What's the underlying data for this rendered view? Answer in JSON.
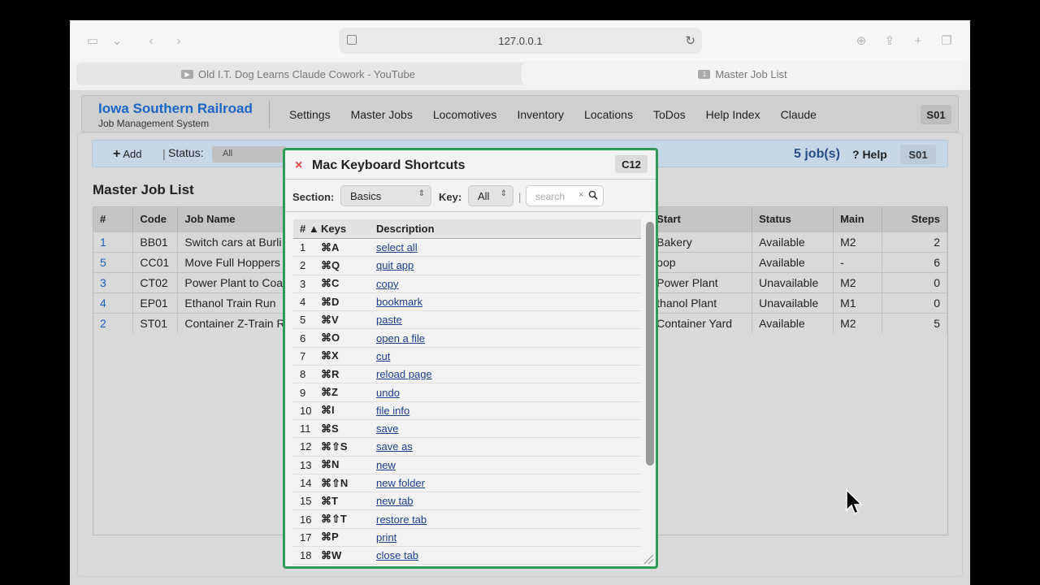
{
  "browser": {
    "url": "127.0.0.1",
    "tabs": [
      {
        "label": "Old I.T. Dog Learns Claude Cowork - YouTube",
        "active": false,
        "icon": "youtube-icon"
      },
      {
        "label": "Master Job List",
        "active": true,
        "icon": "tab-number-icon",
        "badge": "1"
      }
    ]
  },
  "header": {
    "title": "Iowa Southern Railroad",
    "subtitle": "Job Management System",
    "nav": [
      "Settings",
      "Master Jobs",
      "Locomotives",
      "Inventory",
      "Locations",
      "ToDos",
      "Help Index",
      "Claude"
    ],
    "code": "S01"
  },
  "actionbar": {
    "add_label": "Add",
    "status_label": "Status:",
    "status_value": "All",
    "job_count": "5 job(s)",
    "help_label": "? Help",
    "code": "S01"
  },
  "page_title": "Master Job List",
  "table": {
    "columns": [
      "#",
      "Code",
      "Job Name",
      "Start",
      "Status",
      "Main",
      "Steps"
    ],
    "rows": [
      {
        "id": "1",
        "code": "BB01",
        "name": "Switch cars at Burli",
        "start": "Bakery",
        "status": "Available",
        "main": "M2",
        "steps": "2"
      },
      {
        "id": "5",
        "code": "CC01",
        "name": "Move Full Hoppers",
        "start": "oop",
        "status": "Available",
        "main": "-",
        "steps": "6"
      },
      {
        "id": "3",
        "code": "CT02",
        "name": "Power Plant to Coa",
        "start": "Power Plant",
        "status": "Unavailable",
        "main": "M2",
        "steps": "0"
      },
      {
        "id": "4",
        "code": "EP01",
        "name": "Ethanol Train Run",
        "start": "thanol Plant",
        "status": "Unavailable",
        "main": "M1",
        "steps": "0"
      },
      {
        "id": "2",
        "code": "ST01",
        "name": "Container Z-Train R",
        "start": "Container Yard",
        "status": "Available",
        "main": "M2",
        "steps": "5"
      }
    ]
  },
  "modal": {
    "title": "Mac Keyboard Shortcuts",
    "code": "C12",
    "section_label": "Section:",
    "section_value": "Basics",
    "key_label": "Key:",
    "key_value": "All",
    "search_placeholder": "search",
    "columns": [
      "# ▲",
      "Keys",
      "Description"
    ],
    "rows": [
      {
        "n": "1",
        "keys": "⌘A",
        "desc": "select all"
      },
      {
        "n": "2",
        "keys": "⌘Q",
        "desc": "quit app"
      },
      {
        "n": "3",
        "keys": "⌘C",
        "desc": "copy"
      },
      {
        "n": "4",
        "keys": "⌘D",
        "desc": "bookmark"
      },
      {
        "n": "5",
        "keys": "⌘V",
        "desc": "paste"
      },
      {
        "n": "6",
        "keys": "⌘O",
        "desc": "open a file"
      },
      {
        "n": "7",
        "keys": "⌘X",
        "desc": "cut"
      },
      {
        "n": "8",
        "keys": "⌘R",
        "desc": "reload page"
      },
      {
        "n": "9",
        "keys": "⌘Z",
        "desc": "undo"
      },
      {
        "n": "10",
        "keys": "⌘I",
        "desc": "file info"
      },
      {
        "n": "11",
        "keys": "⌘S",
        "desc": "save"
      },
      {
        "n": "12",
        "keys": "⌘⇧S",
        "desc": "save as"
      },
      {
        "n": "13",
        "keys": "⌘N",
        "desc": "new"
      },
      {
        "n": "14",
        "keys": "⌘⇧N",
        "desc": "new folder"
      },
      {
        "n": "15",
        "keys": "⌘T",
        "desc": "new tab"
      },
      {
        "n": "16",
        "keys": "⌘⇧T",
        "desc": "restore tab"
      },
      {
        "n": "17",
        "keys": "⌘P",
        "desc": "print"
      },
      {
        "n": "18",
        "keys": "⌘W",
        "desc": "close tab"
      }
    ]
  },
  "colors": {
    "brand": "#1b67c9",
    "modal_border": "#2e9a5a",
    "close": "#e04444",
    "link": "#1a3f8f"
  }
}
